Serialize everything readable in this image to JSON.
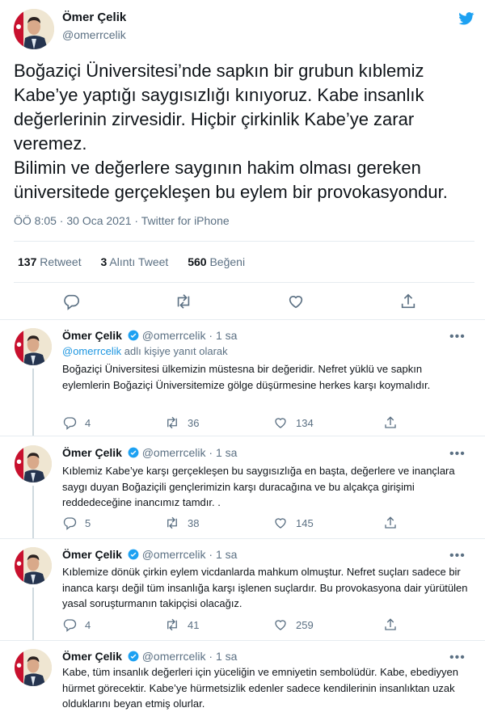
{
  "main_tweet": {
    "name": "Ömer Çelik",
    "handle": "@omerrcelik",
    "text": "Boğaziçi Üniversitesi’nde sapkın bir grubun kıblemiz\nKabe’ye yaptığı saygısızlığı kınıyoruz. Kabe insanlık\ndeğerlerinin zirvesidir. Hiçbir çirkinlik Kabe’ye zarar\nveremez.\nBilimin ve değerlere saygının hakim olması gereken\nüniversitede gerçekleşen bu eylem bir provokasyondur.",
    "meta": "ÖÖ 8:05 · 30 Oca 2021 · Twitter for iPhone",
    "stats": [
      {
        "count": "137",
        "label": "Retweet"
      },
      {
        "count": "3",
        "label": "Alıntı Tweet"
      },
      {
        "count": "560",
        "label": "Beğeni"
      }
    ],
    "icons": [
      "reply-icon",
      "retweet-icon",
      "like-icon",
      "share-icon"
    ]
  },
  "replies": [
    {
      "name": "Ömer Çelik",
      "handle": "@omerrcelik",
      "time": "· 1 sa",
      "reply_to_mention": "@omerrcelik",
      "reply_to_suffix": " adlı kişiye yanıt olarak",
      "text": "Boğaziçi Üniversitesi ülkemizin müstesna bir değeridir. Nefret yüklü ve sapkın eylemlerin Boğaziçi Üniversitemize gölge düşürmesine herkes karşı koymalıdır.",
      "replies": "4",
      "retweets": "36",
      "likes": "134"
    },
    {
      "name": "Ömer Çelik",
      "handle": "@omerrcelik",
      "time": "· 1 sa",
      "text": "Kıblemiz Kabe’ye karşı gerçekleşen bu saygısızlığa en başta, değerlere ve inançlara saygı duyan Boğaziçili gençlerimizin  karşı duracağına ve bu alçakça girişimi reddedeceğine inancımız tamdır. .",
      "replies": "5",
      "retweets": "38",
      "likes": "145"
    },
    {
      "name": "Ömer Çelik",
      "handle": "@omerrcelik",
      "time": "· 1 sa",
      "text": "Kıblemize dönük çirkin eylem vicdanlarda  mahkum olmuştur. Nefret suçları sadece bir inanca karşı değil tüm insanlığa karşı işlenen suçlardır. Bu provokasyona dair yürütülen yasal soruşturmanın takipçisi olacağız.",
      "replies": "4",
      "retweets": "41",
      "likes": "259"
    },
    {
      "name": "Ömer Çelik",
      "handle": "@omerrcelik",
      "time": "· 1 sa",
      "text": "Kabe, tüm insanlık değerleri için yüceliğin ve emniyetin sembolüdür. Kabe, ebediyyen hürmet görecektir. Kabe’ye hürmetsizlik edenler sadece kendilerinin insanlıktan uzak olduklarını beyan etmiş olurlar."
    }
  ],
  "colors": {
    "text": "#0f1419",
    "secondary": "#5b7083",
    "accent": "#1da1f2",
    "mention": "#1b95e0",
    "divider": "#e6ecf0"
  }
}
